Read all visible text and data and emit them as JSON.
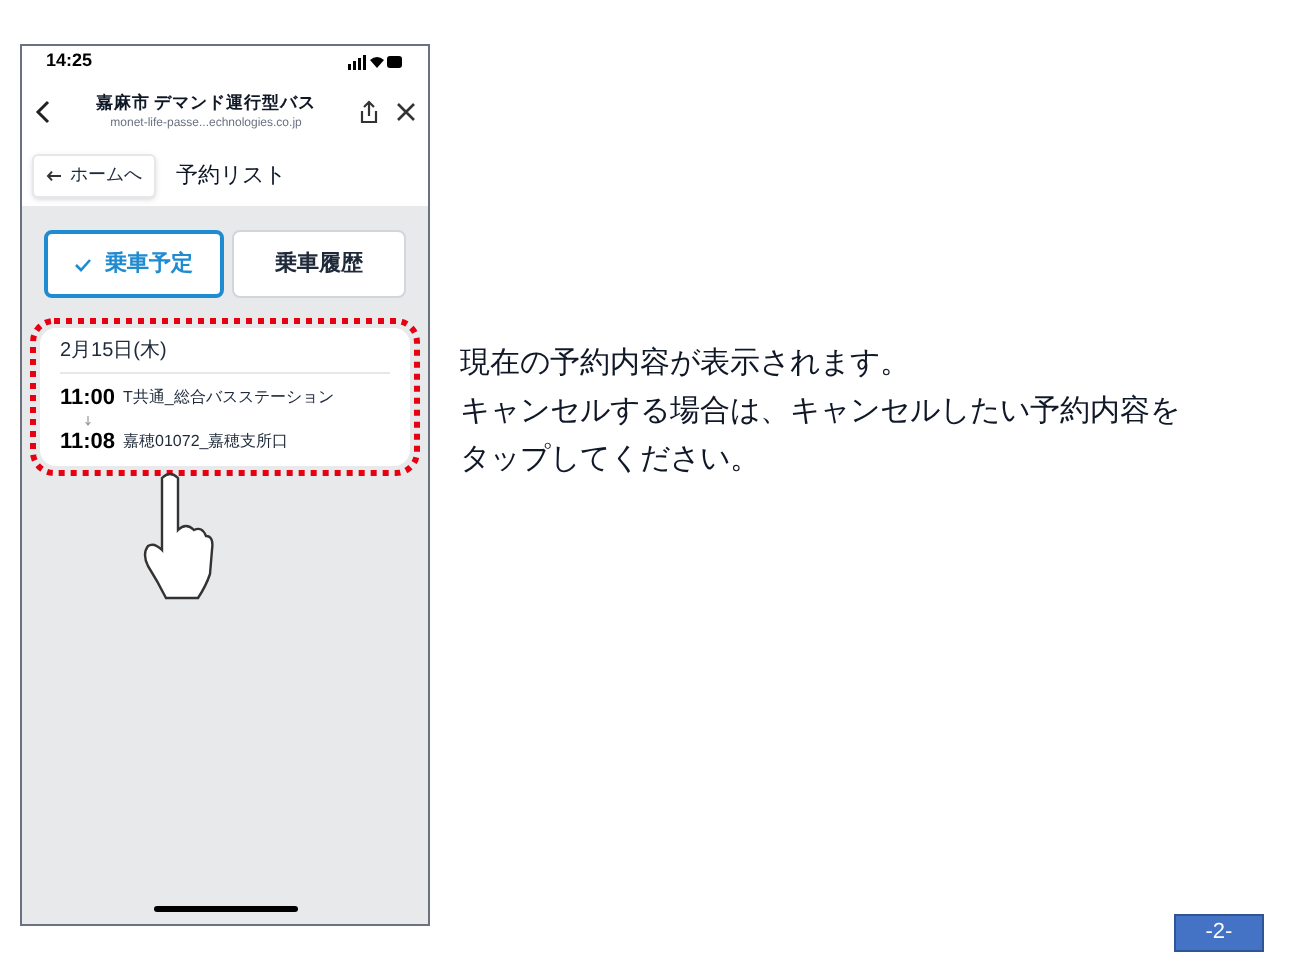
{
  "phone": {
    "status_bar": {
      "time": "14:25"
    },
    "header": {
      "title": "嘉麻市 デマンド運行型バス",
      "url": "monet-life-passe...echnologies.co.jp"
    },
    "home_button": "ホームへ",
    "page_title": "予約リスト",
    "tabs": [
      {
        "label": "乗車予定",
        "selected": true
      },
      {
        "label": "乗車履歴",
        "selected": false
      }
    ],
    "reservations": [
      {
        "date": "2月15日(木)",
        "departure_time": "11:00",
        "departure_stop": "T共通_総合バスステーション",
        "arrival_time": "11:08",
        "arrival_stop": "嘉穂01072_嘉穂支所口"
      }
    ]
  },
  "description": [
    "現在の予約内容が表示されます。",
    "キャンセルする場合は、キャンセルしたい予約内容を",
    "タップしてください。"
  ],
  "page_number": "-2-"
}
